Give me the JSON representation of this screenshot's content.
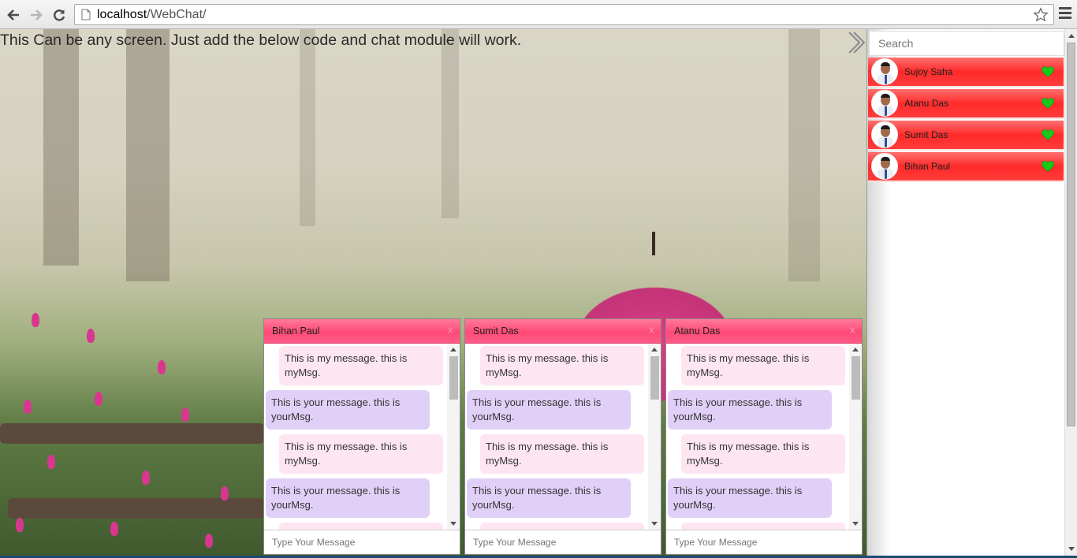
{
  "browser": {
    "url_host": "localhost",
    "url_path": "/WebChat/"
  },
  "page": {
    "headline": "This Can be any screen. Just add the below code and chat module will work."
  },
  "sidebar": {
    "search_placeholder": "Search",
    "contacts": [
      {
        "name": "Sujoy Saha",
        "status_color": "#19c919"
      },
      {
        "name": "Atanu Das",
        "status_color": "#19c919"
      },
      {
        "name": "Sumit Das",
        "status_color": "#19c919"
      },
      {
        "name": "Bihan Paul",
        "status_color": "#19c919"
      }
    ]
  },
  "chats": [
    {
      "title": "Bihan Paul",
      "close_label": "X",
      "messages": [
        {
          "type": "mine",
          "text": "This is my message. this is myMsg."
        },
        {
          "type": "yours",
          "text": "This is your message. this is yourMsg."
        },
        {
          "type": "mine",
          "text": "This is my message. this is myMsg."
        },
        {
          "type": "yours",
          "text": "This is your message. this is yourMsg."
        }
      ],
      "input_placeholder": "Type Your Message"
    },
    {
      "title": "Sumit Das",
      "close_label": "X",
      "messages": [
        {
          "type": "mine",
          "text": "This is my message. this is myMsg."
        },
        {
          "type": "yours",
          "text": "This is your message. this is yourMsg."
        },
        {
          "type": "mine",
          "text": "This is my message. this is myMsg."
        },
        {
          "type": "yours",
          "text": "This is your message. this is yourMsg."
        }
      ],
      "input_placeholder": "Type Your Message"
    },
    {
      "title": "Atanu Das",
      "close_label": "X",
      "messages": [
        {
          "type": "mine",
          "text": "This is my message. this is myMsg."
        },
        {
          "type": "yours",
          "text": "This is your message. this is yourMsg."
        },
        {
          "type": "mine",
          "text": "This is my message. this is myMsg."
        },
        {
          "type": "yours",
          "text": "This is your message. this is yourMsg."
        }
      ],
      "input_placeholder": "Type Your Message"
    }
  ],
  "colors": {
    "contact_bar": "#ff3b3b",
    "chat_header": "#ff5b85",
    "my_message_bg": "#fde5f2",
    "your_message_bg": "#e0d0f8",
    "online_heart": "#19c919"
  },
  "icons": {
    "back": "back-arrow-icon",
    "forward": "forward-arrow-icon",
    "reload": "reload-icon",
    "page": "page-icon",
    "bookmark": "star-icon",
    "menu": "hamburger-menu-icon",
    "toggle": "chevron-right-icon",
    "status": "heart-icon"
  }
}
